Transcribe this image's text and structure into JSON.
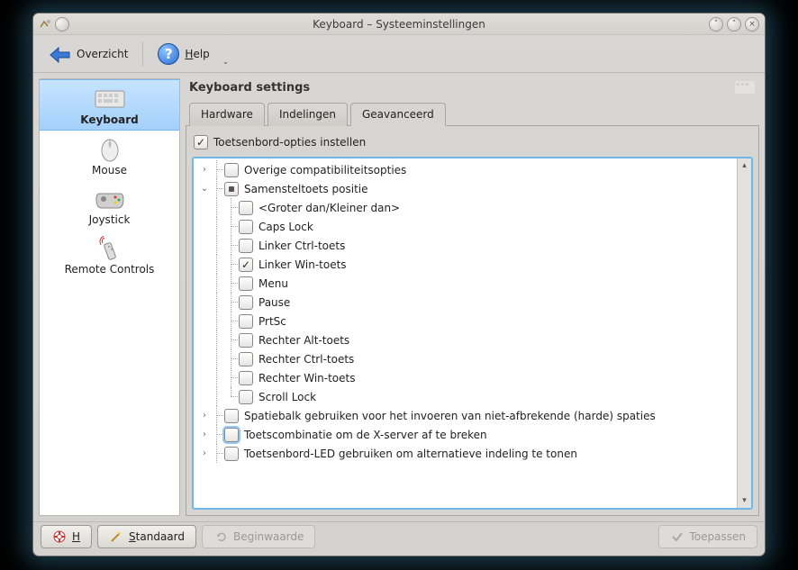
{
  "window": {
    "title": "Keyboard – Systeeminstellingen"
  },
  "toolbar": {
    "overview": "Overzicht",
    "help": "Help"
  },
  "sidebar": {
    "items": [
      {
        "label": "Keyboard"
      },
      {
        "label": "Mouse"
      },
      {
        "label": "Joystick"
      },
      {
        "label": "Remote Controls"
      }
    ]
  },
  "content": {
    "title": "Keyboard settings",
    "tabs": [
      {
        "label": "Hardware"
      },
      {
        "label": "Indelingen"
      },
      {
        "label": "Geavanceerd"
      }
    ],
    "top_option": "Toetsenbord-opties instellen",
    "tree": {
      "row0": "Overige compatibiliteitsopties",
      "row1": "Samensteltoets positie",
      "children": [
        "<Groter dan/Kleiner dan>",
        "Caps Lock",
        "Linker Ctrl-toets",
        "Linker Win-toets",
        "Menu",
        "Pause",
        "PrtSc",
        "Rechter Alt-toets",
        "Rechter Ctrl-toets",
        "Rechter Win-toets",
        "Scroll Lock"
      ],
      "row2": "Spatiebalk gebruiken voor het invoeren van niet-afbrekende (harde) spaties",
      "row3": "Toetscombinatie om de X-server af te breken",
      "row4": "Toetsenbord-LED gebruiken om alternatieve indeling te tonen"
    }
  },
  "footer": {
    "help": "Help",
    "default": "Standaard",
    "reset": "Beginwaarde",
    "apply": "Toepassen"
  }
}
